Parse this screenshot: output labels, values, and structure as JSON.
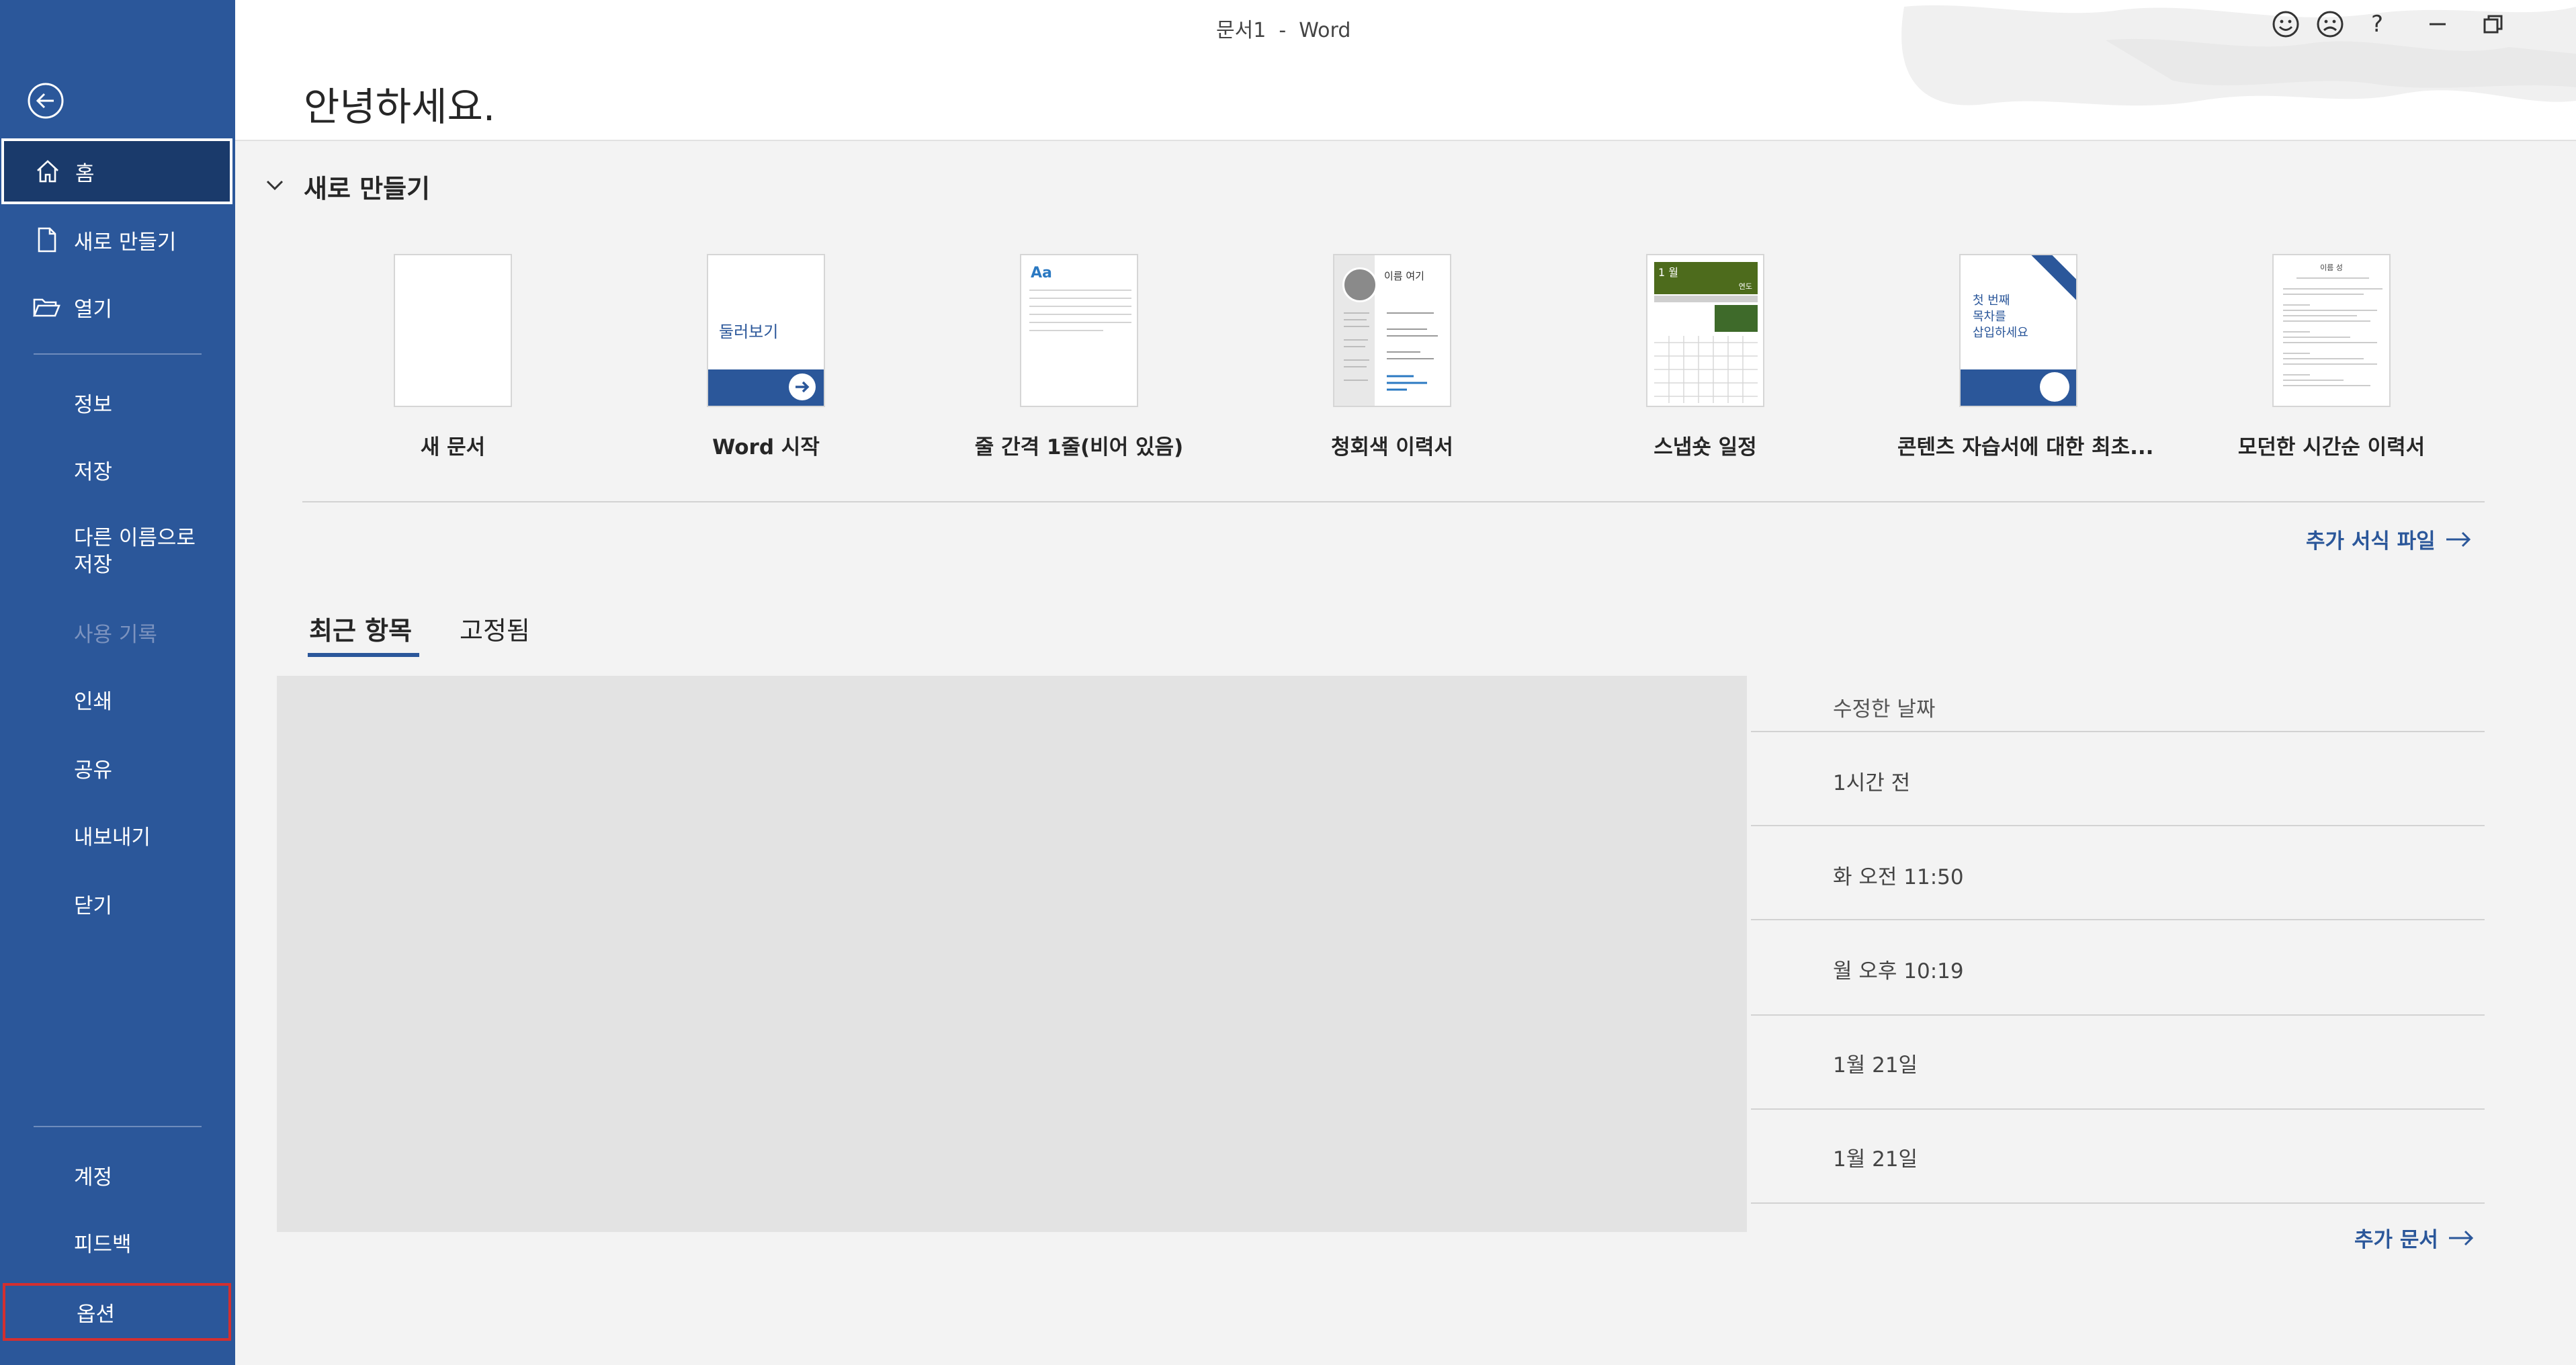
{
  "window": {
    "title": "문서1  -  Word"
  },
  "title_controls": [
    "smiley-icon",
    "frown-icon",
    "?",
    "minimize",
    "restore"
  ],
  "sidebar": {
    "items": [
      {
        "label": "홈",
        "icon": "home-icon",
        "selected": true
      },
      {
        "label": "새로 만들기",
        "icon": "new-doc-icon"
      },
      {
        "label": "열기",
        "icon": "folder-open-icon"
      },
      {
        "label": "정보"
      },
      {
        "label": "저장"
      },
      {
        "label": "다른 이름으로 저장"
      },
      {
        "label": "사용 기록",
        "disabled": true
      },
      {
        "label": "인쇄"
      },
      {
        "label": "공유"
      },
      {
        "label": "내보내기"
      },
      {
        "label": "닫기"
      },
      {
        "label": "계정"
      },
      {
        "label": "피드백"
      },
      {
        "label": "옵션",
        "highlighted": true
      }
    ],
    "save_as_line1": "다른 이름으로",
    "save_as_line2": "저장"
  },
  "main": {
    "greeting": "안녕하세요.",
    "new_section_title": "새로 만들기",
    "templates": [
      {
        "name": "새 문서"
      },
      {
        "name": "Word 시작",
        "thumb_text": "둘러보기"
      },
      {
        "name": "줄 간격 1줄(비어 있음)",
        "thumb_text": "Aa"
      },
      {
        "name": "청회색 이력서",
        "thumb_text": "이름 여기"
      },
      {
        "name": "스냅숏 일정",
        "thumb_text": "1 월",
        "thumb_text2": "연도"
      },
      {
        "name": "콘텐츠 자습서에 대한 최초...",
        "thumb_text": "첫 번째\n목차를\n삽입하세요"
      },
      {
        "name": "모던한 시간순 이력서",
        "thumb_text": "이름 성"
      }
    ],
    "more_templates": "추가 서식 파일",
    "tabs": [
      "최근 항목",
      "고정됨"
    ],
    "column_header": "수정한 날짜",
    "recent_dates": [
      "1시간 전",
      "화 오전 11:50",
      "월 오후 10:19",
      "1월 21일",
      "1월 21일"
    ],
    "more_documents": "추가 문서"
  },
  "colors": {
    "accent": "#2b579a",
    "sidebar_selected": "#1a3a6b",
    "options_outline": "#d32f2f"
  }
}
